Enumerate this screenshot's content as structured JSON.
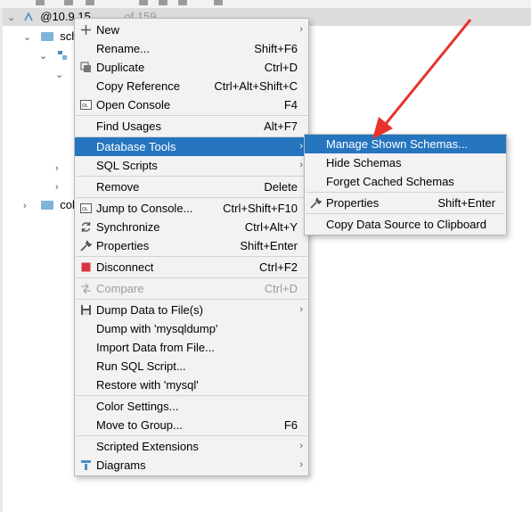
{
  "tree": {
    "connection_label": "@10.9.15",
    "connection_suffix": "of 159",
    "folder1": "sch",
    "folder2": "coll"
  },
  "context_menu": [
    {
      "label": "New",
      "shortcut": "",
      "submenu": true,
      "icon": "plus-icon"
    },
    {
      "label": "Rename...",
      "shortcut": "Shift+F6"
    },
    {
      "label": "Duplicate",
      "shortcut": "Ctrl+D",
      "icon": "duplicate-icon"
    },
    {
      "label": "Copy Reference",
      "shortcut": "Ctrl+Alt+Shift+C"
    },
    {
      "label": "Open Console",
      "shortcut": "F4",
      "icon": "console-icon"
    },
    {
      "label": "Find Usages",
      "shortcut": "Alt+F7"
    },
    {
      "label": "Database Tools",
      "shortcut": "",
      "submenu": true,
      "active": true
    },
    {
      "label": "SQL Scripts",
      "shortcut": "",
      "submenu": true
    },
    {
      "label": "Remove",
      "shortcut": "Delete"
    },
    {
      "label": "Jump to Console...",
      "shortcut": "Ctrl+Shift+F10",
      "icon": "console-icon"
    },
    {
      "label": "Synchronize",
      "shortcut": "Ctrl+Alt+Y",
      "icon": "sync-icon"
    },
    {
      "label": "Properties",
      "shortcut": "Shift+Enter",
      "icon": "wrench-icon"
    },
    {
      "label": "Disconnect",
      "shortcut": "Ctrl+F2",
      "icon": "stop-icon"
    },
    {
      "label": "Compare",
      "shortcut": "Ctrl+D",
      "disabled": true,
      "icon": "compare-icon"
    },
    {
      "label": "Dump Data to File(s)",
      "shortcut": "",
      "submenu": true,
      "icon": "save-icon"
    },
    {
      "label": "Dump with 'mysqldump'",
      "shortcut": ""
    },
    {
      "label": "Import Data from File...",
      "shortcut": ""
    },
    {
      "label": "Run SQL Script...",
      "shortcut": ""
    },
    {
      "label": "Restore with 'mysql'",
      "shortcut": ""
    },
    {
      "label": "Color Settings...",
      "shortcut": ""
    },
    {
      "label": "Move to Group...",
      "shortcut": "F6"
    },
    {
      "label": "Scripted Extensions",
      "shortcut": "",
      "submenu": true
    },
    {
      "label": "Diagrams",
      "shortcut": "",
      "submenu": true,
      "icon": "diagram-icon"
    }
  ],
  "submenu": [
    {
      "label": "Manage Shown Schemas...",
      "shortcut": "",
      "active": true
    },
    {
      "label": "Hide Schemas",
      "shortcut": ""
    },
    {
      "label": "Forget Cached Schemas",
      "shortcut": ""
    },
    {
      "label": "Properties",
      "shortcut": "Shift+Enter",
      "icon": "wrench-icon"
    },
    {
      "label": "Copy Data Source to Clipboard",
      "shortcut": ""
    }
  ],
  "colors": {
    "accent": "#2675bf",
    "menu_bg": "#f2f2f2",
    "arrow": "#e8322c",
    "stop": "#d9363e"
  }
}
